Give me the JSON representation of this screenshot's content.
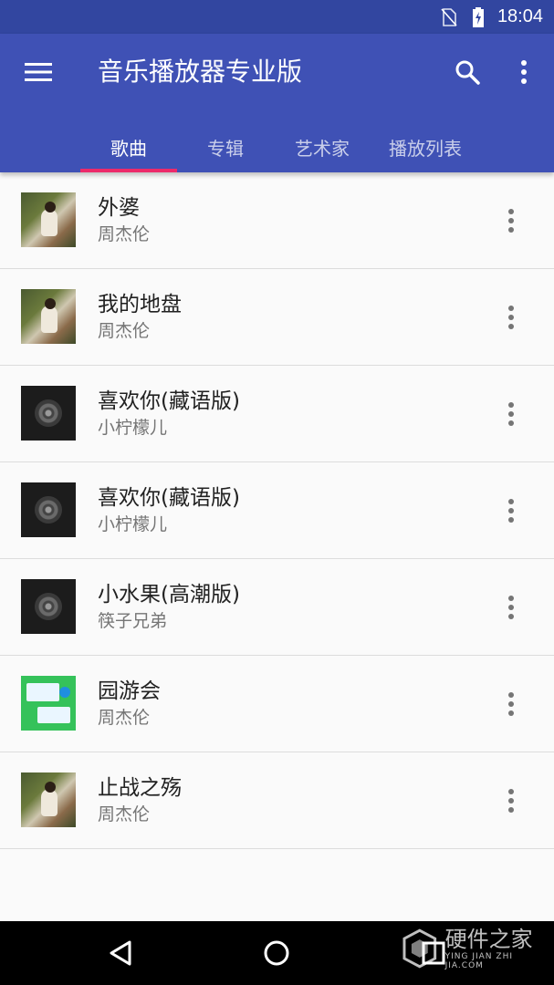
{
  "status_bar": {
    "time": "18:04"
  },
  "toolbar": {
    "title": "音乐播放器专业版"
  },
  "tabs": [
    {
      "label": "歌曲",
      "active": true
    },
    {
      "label": "专辑",
      "active": false
    },
    {
      "label": "艺术家",
      "active": false
    },
    {
      "label": "播放列表",
      "active": false
    }
  ],
  "songs": [
    {
      "title": "外婆",
      "artist": "周杰伦",
      "cover": "photo"
    },
    {
      "title": "我的地盘",
      "artist": "周杰伦",
      "cover": "photo"
    },
    {
      "title": "喜欢你(藏语版)",
      "artist": "小柠檬儿",
      "cover": "disc"
    },
    {
      "title": "喜欢你(藏语版)",
      "artist": "小柠檬儿",
      "cover": "disc"
    },
    {
      "title": "小水果(高潮版)",
      "artist": "筷子兄弟",
      "cover": "disc"
    },
    {
      "title": "园游会",
      "artist": "周杰伦",
      "cover": "green"
    },
    {
      "title": "止战之殇",
      "artist": "周杰伦",
      "cover": "photo"
    }
  ],
  "watermark": {
    "main": "硬件之家",
    "sub": "YING JIAN ZHI JIA.COM"
  },
  "colors": {
    "primary": "#3f51b5",
    "primary_dark": "#3246a0",
    "accent": "#ec2a6a"
  }
}
